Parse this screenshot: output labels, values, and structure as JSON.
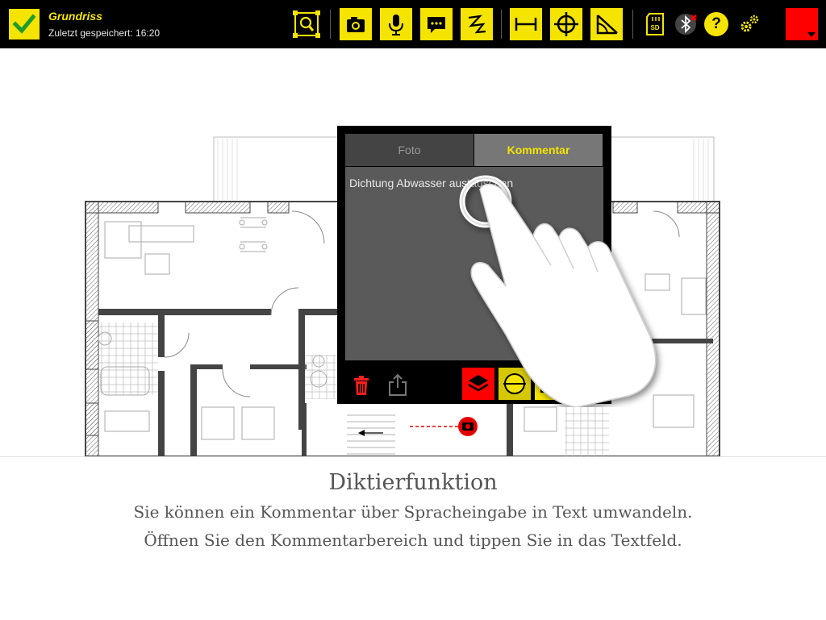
{
  "app": {
    "title": "Grundriss",
    "subtitle": "Zuletzt gespeichert: 16:20",
    "accent_color": "#f5e400",
    "selected_color": "#ff0000"
  },
  "toolbar": {
    "icons": [
      "check-icon",
      "zoom-extent-icon",
      "camera-icon",
      "microphone-icon",
      "comment-icon",
      "freehand-line-icon",
      "measure-distance-icon",
      "crosshair-icon",
      "angle-measure-icon",
      "sd-card-icon",
      "bluetooth-off-icon",
      "help-icon",
      "settings-icon",
      "color-picker"
    ],
    "help_label": "?"
  },
  "popup": {
    "tab_foto": "Foto",
    "tab_kommentar": "Kommentar",
    "active_tab": "Kommentar",
    "comment_text": "Dichtung Abwasser austauschen",
    "bottom_icons": [
      "trash-icon",
      "share-icon",
      "layers-icon",
      "pin-target-icon",
      "image-icon",
      "more-icon"
    ]
  },
  "caption": {
    "title": "Diktierfunktion",
    "line1": "Sie können ein Kommentar über Spracheingabe in Text umwandeln.",
    "line2": "Öffnen Sie den Kommentarbereich und tippen Sie in das Textfeld."
  }
}
